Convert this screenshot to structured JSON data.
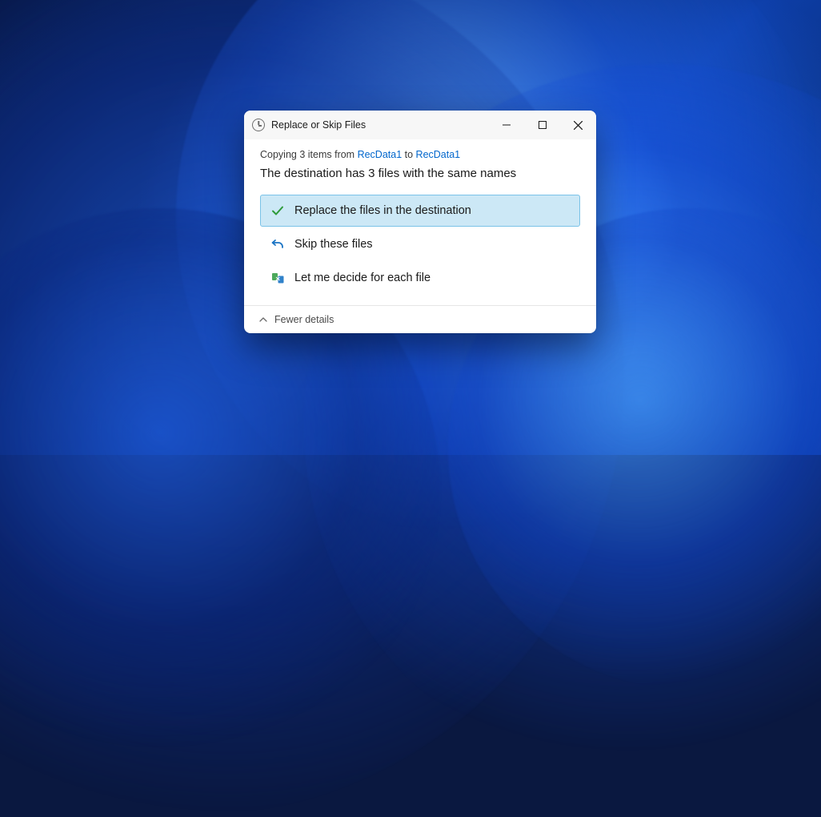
{
  "dialog": {
    "title": "Replace or Skip Files",
    "copying_prefix": "Copying 3 items from ",
    "source": "RecData1",
    "copying_mid": " to ",
    "destination": "RecData1",
    "headline": "The destination has 3 files with the same names",
    "options": {
      "replace": "Replace the files in the destination",
      "skip": "Skip these files",
      "decide": "Let me decide for each file"
    },
    "footer": "Fewer details"
  }
}
